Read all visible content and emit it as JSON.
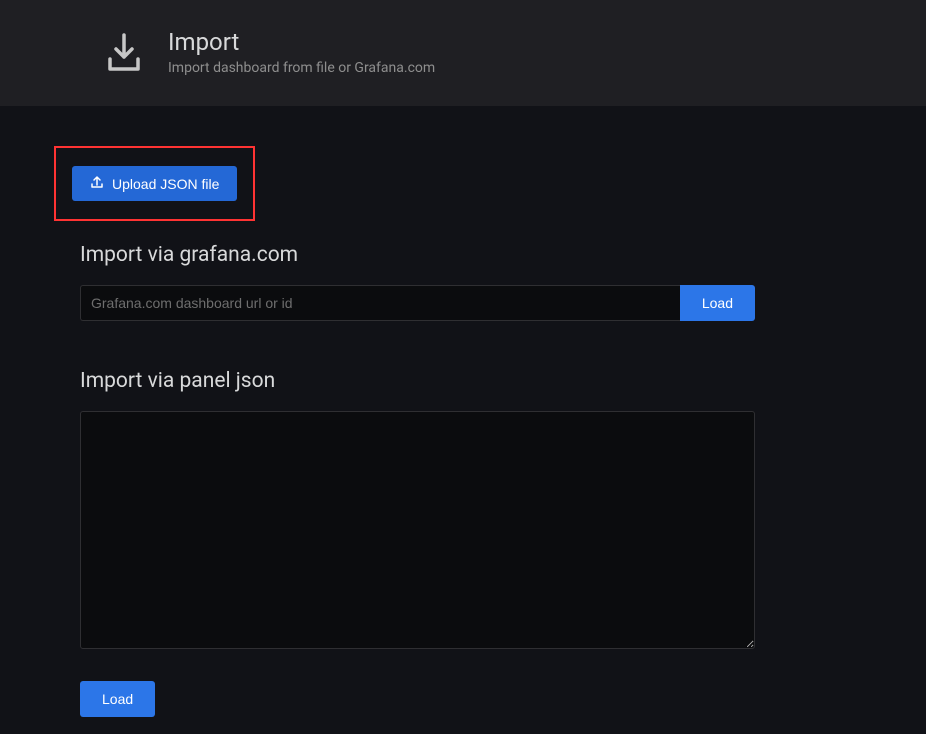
{
  "header": {
    "title": "Import",
    "subtitle": "Import dashboard from file or Grafana.com"
  },
  "upload": {
    "button_label": "Upload JSON file"
  },
  "import_url": {
    "section_title": "Import via grafana.com",
    "placeholder": "Grafana.com dashboard url or id",
    "load_label": "Load"
  },
  "import_json": {
    "section_title": "Import via panel json",
    "load_label": "Load"
  }
}
